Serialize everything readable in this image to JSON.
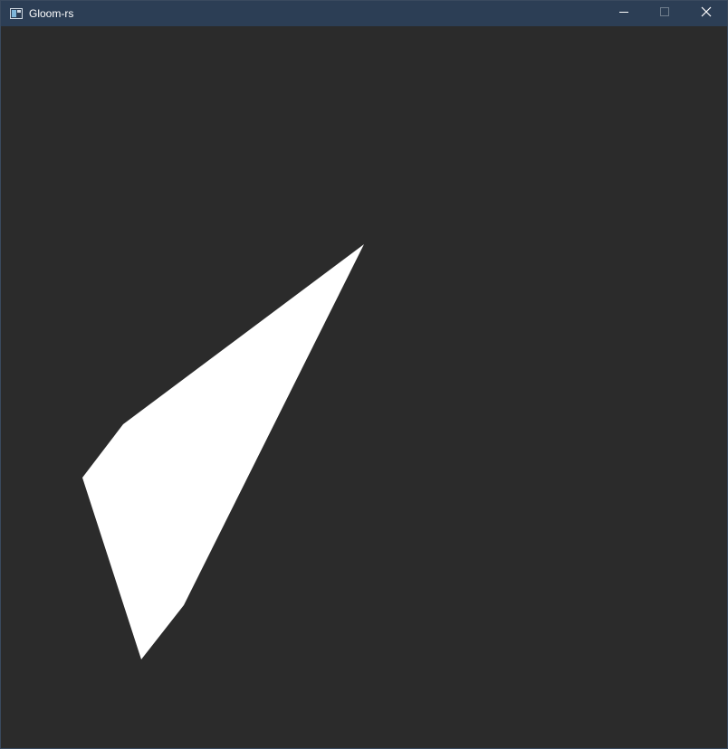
{
  "window": {
    "title": "Gloom-rs",
    "app_icon": "window-app-icon",
    "controls": {
      "minimize_icon": "minimize-icon",
      "maximize_icon": "maximize-icon",
      "close_icon": "close-icon"
    }
  },
  "colors": {
    "titlebar": "#2c3e55",
    "background": "#2b2b2b",
    "shape_fill": "#ffffff",
    "title_text": "#ffffff"
  }
}
